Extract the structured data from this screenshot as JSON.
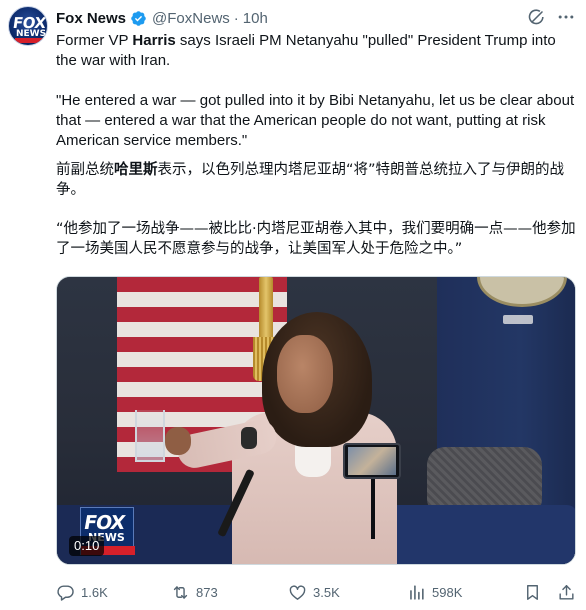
{
  "author": {
    "display_name": "Fox News",
    "handle": "@FoxNews",
    "separator": "·",
    "time": "10h",
    "avatar_icon": "fox-news-logo",
    "verified_icon": "verified-badge-icon",
    "verified_color": "#1d9bf0"
  },
  "post": {
    "line1_prefix": "Former VP ",
    "line1_bold": "Harris",
    "line1_suffix": " says Israeli PM Netanyahu \"pulled\" President Trump into the war with Iran.",
    "quote_en": "\"He entered a war — got pulled into it by Bibi Netanyahu, let us be clear about that — entered a war that the American people do not want, putting at risk American service members.\"",
    "zh_prefix": "前副总统",
    "zh_bold": "哈里斯",
    "zh_suffix": "表示，以色列总理内塔尼亚胡“将”特朗普总统拉入了与伊朗的战争。",
    "quote_zh": "“他参加了一场战争——被比比·内塔尼亚胡卷入其中，我们要明确一点——他参加了一场美国人民不愿意参与的战争，让美国军人处于危险之中。”"
  },
  "media": {
    "type": "video",
    "duration": "0:10",
    "channel_logo_top": "FOX",
    "channel_logo_bottom": "NEWS"
  },
  "actions": {
    "reply_count": "1.6K",
    "repost_count": "873",
    "like_count": "3.5K",
    "views_count": "598K",
    "icon_color": "#536471"
  }
}
